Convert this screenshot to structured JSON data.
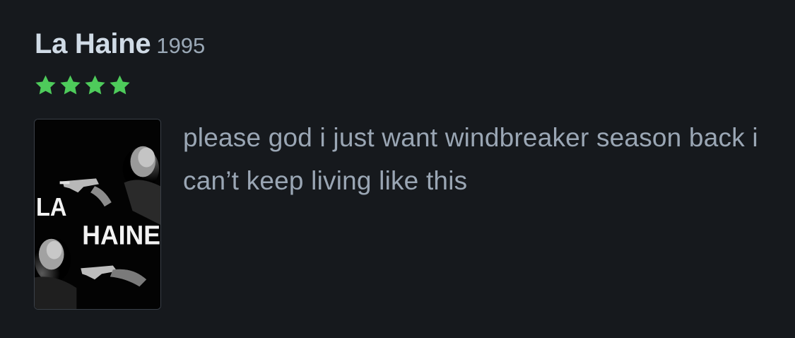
{
  "film": {
    "title": "La Haine",
    "year": "1995"
  },
  "rating": {
    "stars": 4,
    "max_stars": 5,
    "icon": "star-icon",
    "color": "#4ecb5b"
  },
  "poster": {
    "title_line1": "LA",
    "title_line2": "HAINE"
  },
  "review": {
    "text": "please god i just want windbreaker season back i can’t keep living like this"
  },
  "colors": {
    "background": "#16191d",
    "title": "#d0dbe6",
    "year": "#9aa8b6",
    "body_text": "#9aa6b4"
  }
}
